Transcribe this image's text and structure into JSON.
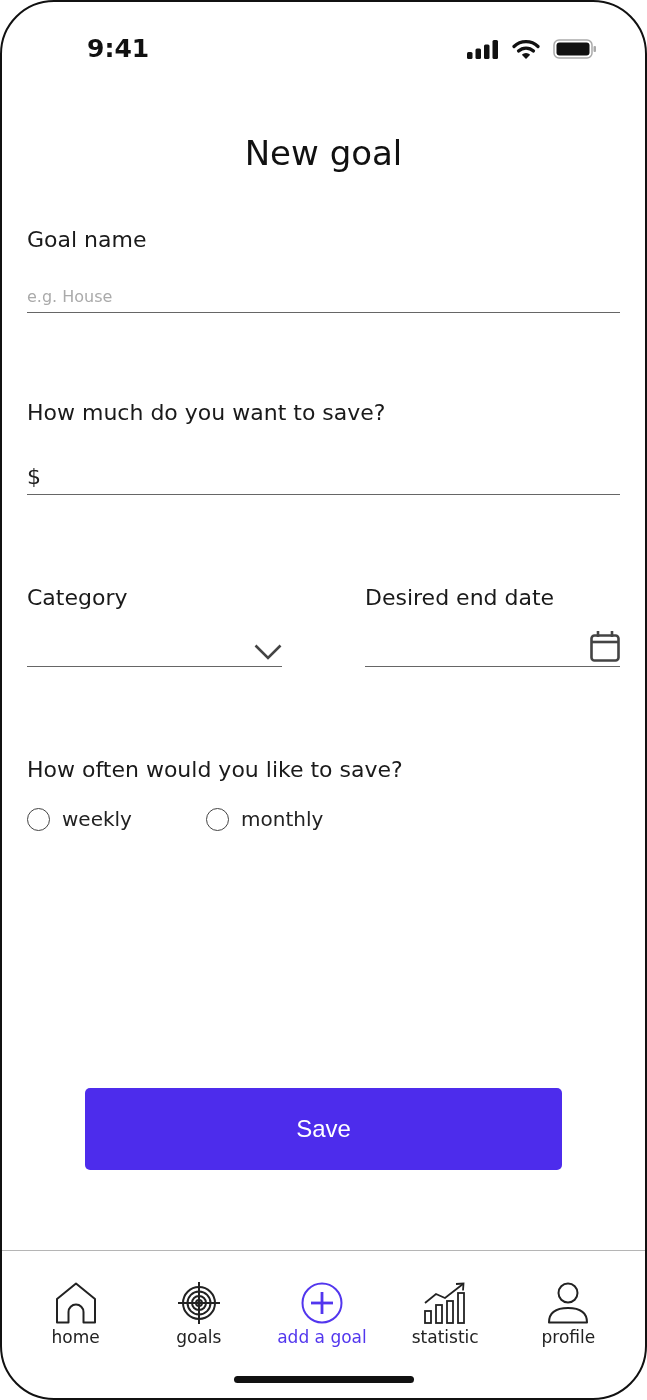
{
  "status_bar": {
    "time": "9:41"
  },
  "title": "New goal",
  "goal_name": {
    "label": "Goal name",
    "placeholder": "e.g. House"
  },
  "amount": {
    "label": "How much do you want to save?",
    "value": "$"
  },
  "category": {
    "label": "Category"
  },
  "end_date": {
    "label": "Desired end date"
  },
  "frequency": {
    "label": "How often would you like to save?",
    "options": [
      {
        "label": "weekly",
        "selected": false
      },
      {
        "label": "monthly",
        "selected": false
      }
    ]
  },
  "save_button": "Save",
  "nav": [
    {
      "label": "home",
      "selected": false
    },
    {
      "label": "goals",
      "selected": false
    },
    {
      "label": "add a goal",
      "selected": true
    },
    {
      "label": "statistic",
      "selected": false
    },
    {
      "label": "profile",
      "selected": false
    }
  ]
}
